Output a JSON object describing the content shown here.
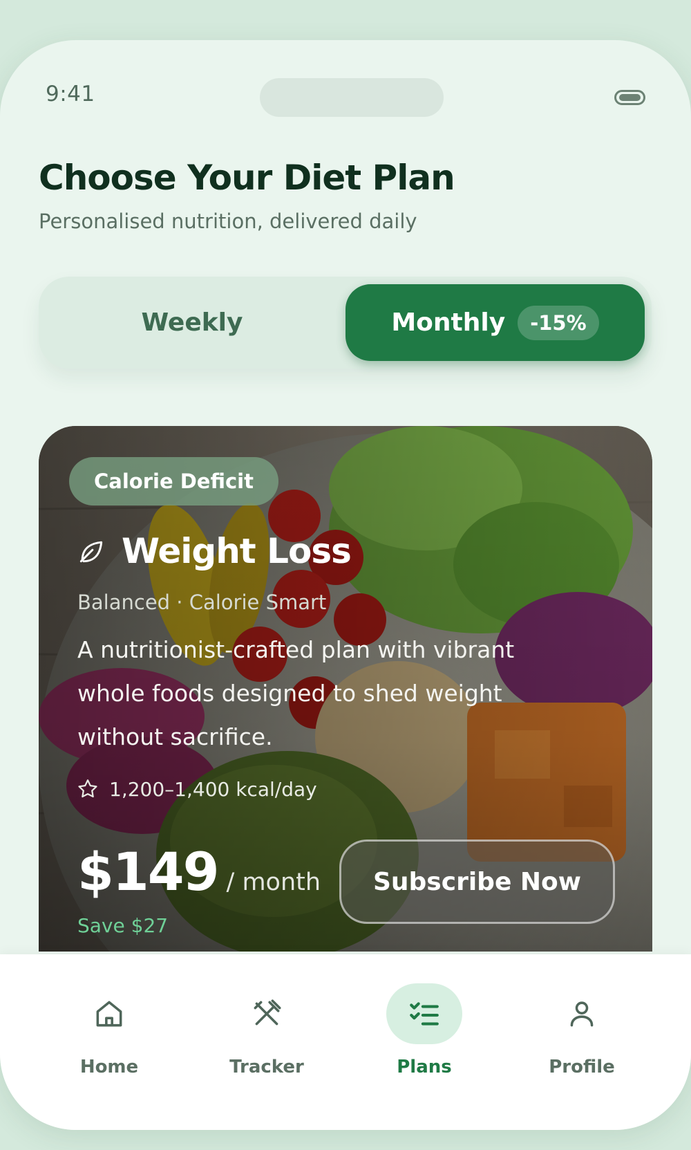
{
  "status_bar": {
    "time": "9:41"
  },
  "header": {
    "title": "Choose Your Diet Plan",
    "subtitle": "Personalised nutrition, delivered daily"
  },
  "billing_toggle": {
    "options": [
      "Weekly",
      "Monthly"
    ],
    "selected": "Monthly",
    "discount_badge": "-15%"
  },
  "plan_card": {
    "tag": "Calorie Deficit",
    "icon": "leaf-icon",
    "title": "Weight Loss",
    "meta": "Balanced · Calorie Smart",
    "description": "A nutritionist-crafted plan with vibrant whole foods designed to shed weight without sacrifice.",
    "kcal": "1,200–1,400 kcal/day",
    "price": "$149",
    "price_unit": "/ month",
    "savings": "Save $27",
    "cta_label": "Subscribe Now"
  },
  "bottom_nav": {
    "items": [
      {
        "label": "Home",
        "icon": "home-icon"
      },
      {
        "label": "Tracker",
        "icon": "utensils-icon"
      },
      {
        "label": "Plans",
        "icon": "checklist-icon"
      },
      {
        "label": "Profile",
        "icon": "user-icon"
      }
    ],
    "active": "Plans"
  },
  "colors": {
    "background": "#eaf5ee",
    "accent": "#1f7a45",
    "title": "#10301f",
    "savings": "#6fd097"
  }
}
